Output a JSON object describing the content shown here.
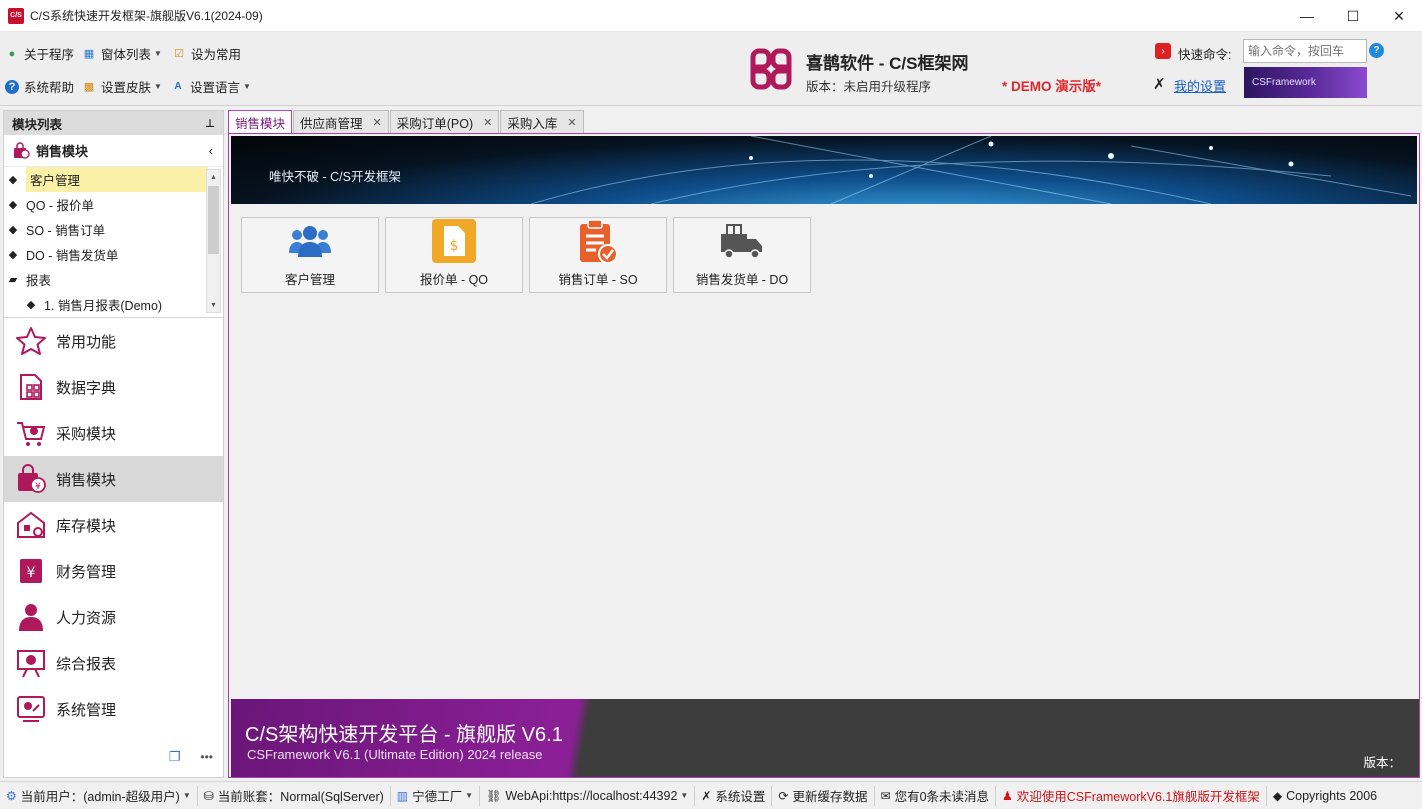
{
  "window": {
    "app_icon": "C/S",
    "title": "C/S系统快速开发框架-旗舰版V6.1(2024-09)",
    "minimize": "—",
    "maximize": "☐",
    "close": "✕"
  },
  "toolbar": {
    "about": "关于程序",
    "window_list": "窗体列表",
    "set_common": "设为常用",
    "help": "系统帮助",
    "skin": "设置皮肤",
    "language": "设置语言"
  },
  "brand": {
    "title": "喜鹊软件 - C/S框架网",
    "version": "版本：未启用升级程序",
    "demo": "* DEMO 演示版*",
    "accent": "#b0185c"
  },
  "quick": {
    "label": "快速命令:",
    "placeholder": "输入命令，按回车",
    "my_settings": "我的设置",
    "badge": "CSFramework"
  },
  "sidebar": {
    "header": "模块列表",
    "pin": "⊐",
    "current_module": "销售模块",
    "tree": [
      {
        "label": "客户管理",
        "selected": true
      },
      {
        "label": "QO - 报价单"
      },
      {
        "label": "SO - 销售订单"
      },
      {
        "label": "DO - 销售发货单"
      },
      {
        "label": "报表",
        "folder": true
      },
      {
        "label": "1. 销售月报表(Demo)",
        "sub": true
      }
    ],
    "nav": [
      {
        "label": "常用功能",
        "icon": "star-icon"
      },
      {
        "label": "数据字典",
        "icon": "dictionary-icon"
      },
      {
        "label": "采购模块",
        "icon": "cart-icon"
      },
      {
        "label": "销售模块",
        "icon": "sales-bag-icon",
        "active": true
      },
      {
        "label": "库存模块",
        "icon": "warehouse-icon"
      },
      {
        "label": "财务管理",
        "icon": "finance-icon"
      },
      {
        "label": "人力资源",
        "icon": "person-icon"
      },
      {
        "label": "综合报表",
        "icon": "report-icon"
      },
      {
        "label": "系统管理",
        "icon": "system-icon"
      }
    ],
    "footer_more": "•••"
  },
  "tabs": [
    {
      "label": "销售模块",
      "active": true,
      "closable": false
    },
    {
      "label": "供应商管理",
      "closable": true
    },
    {
      "label": "采购订单(PO)",
      "closable": true
    },
    {
      "label": "采购入库",
      "closable": true
    }
  ],
  "main": {
    "banner_text": "唯快不破 - C/S开发框架",
    "tiles": [
      {
        "label": "客户管理",
        "icon": "customers-icon"
      },
      {
        "label": "报价单 - QO",
        "icon": "quote-document-icon"
      },
      {
        "label": "销售订单 - SO",
        "icon": "sales-order-clipboard-icon"
      },
      {
        "label": "销售发货单 - DO",
        "icon": "delivery-truck-icon"
      }
    ],
    "footer_title": "C/S架构快速开发平台 - 旗舰版 V6.1",
    "footer_sub": "CSFramework V6.1 (Ultimate Edition) 2024 release",
    "footer_version": "版本："
  },
  "status": {
    "user": "当前用户：(admin-超级用户)",
    "account": "当前账套：Normal(SqlServer)",
    "factory": "宁德工厂",
    "webapi": "WebApi:https://localhost:44392",
    "settings": "系统设置",
    "refresh": "更新缓存数据",
    "messages": "您有0条未读消息",
    "welcome": "欢迎使用CSFrameworkV6.1旗舰版开发框架",
    "copyright": "Copyrights 2006"
  }
}
